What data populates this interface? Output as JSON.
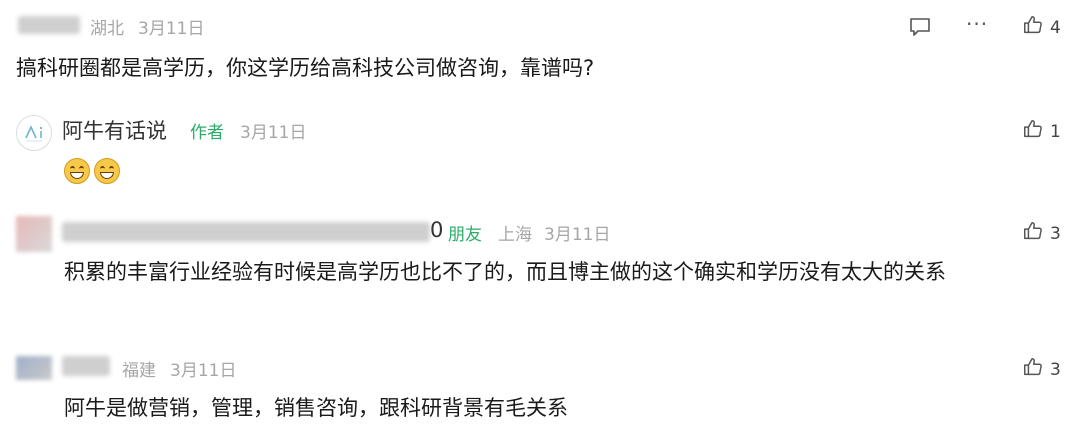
{
  "comments": [
    {
      "location": "湖北",
      "date": "3月11日",
      "text": "搞科研圈都是高学历，你这学历给高科技公司做咨询，靠谱吗?",
      "likes": "4",
      "more_label": "···"
    },
    {
      "name": "阿牛有话说",
      "author_tag": "作者",
      "date": "3月11日",
      "likes": "1"
    },
    {
      "name_tail": "0",
      "friend_tag": "朋友",
      "location": "上海",
      "date": "3月11日",
      "text": "积累的丰富行业经验有时候是高学历也比不了的，而且博主做的这个确实和学历没有太大的关系",
      "likes": "3"
    },
    {
      "location": "福建",
      "date": "3月11日",
      "text": "阿牛是做营销，管理，销售咨询，跟科研背景有毛关系",
      "likes": "3"
    }
  ],
  "icons": {
    "comment": "comment-icon",
    "like": "thumbs-up-icon",
    "emoji": "grinning-face-icon",
    "logo": "author-logo-icon"
  }
}
